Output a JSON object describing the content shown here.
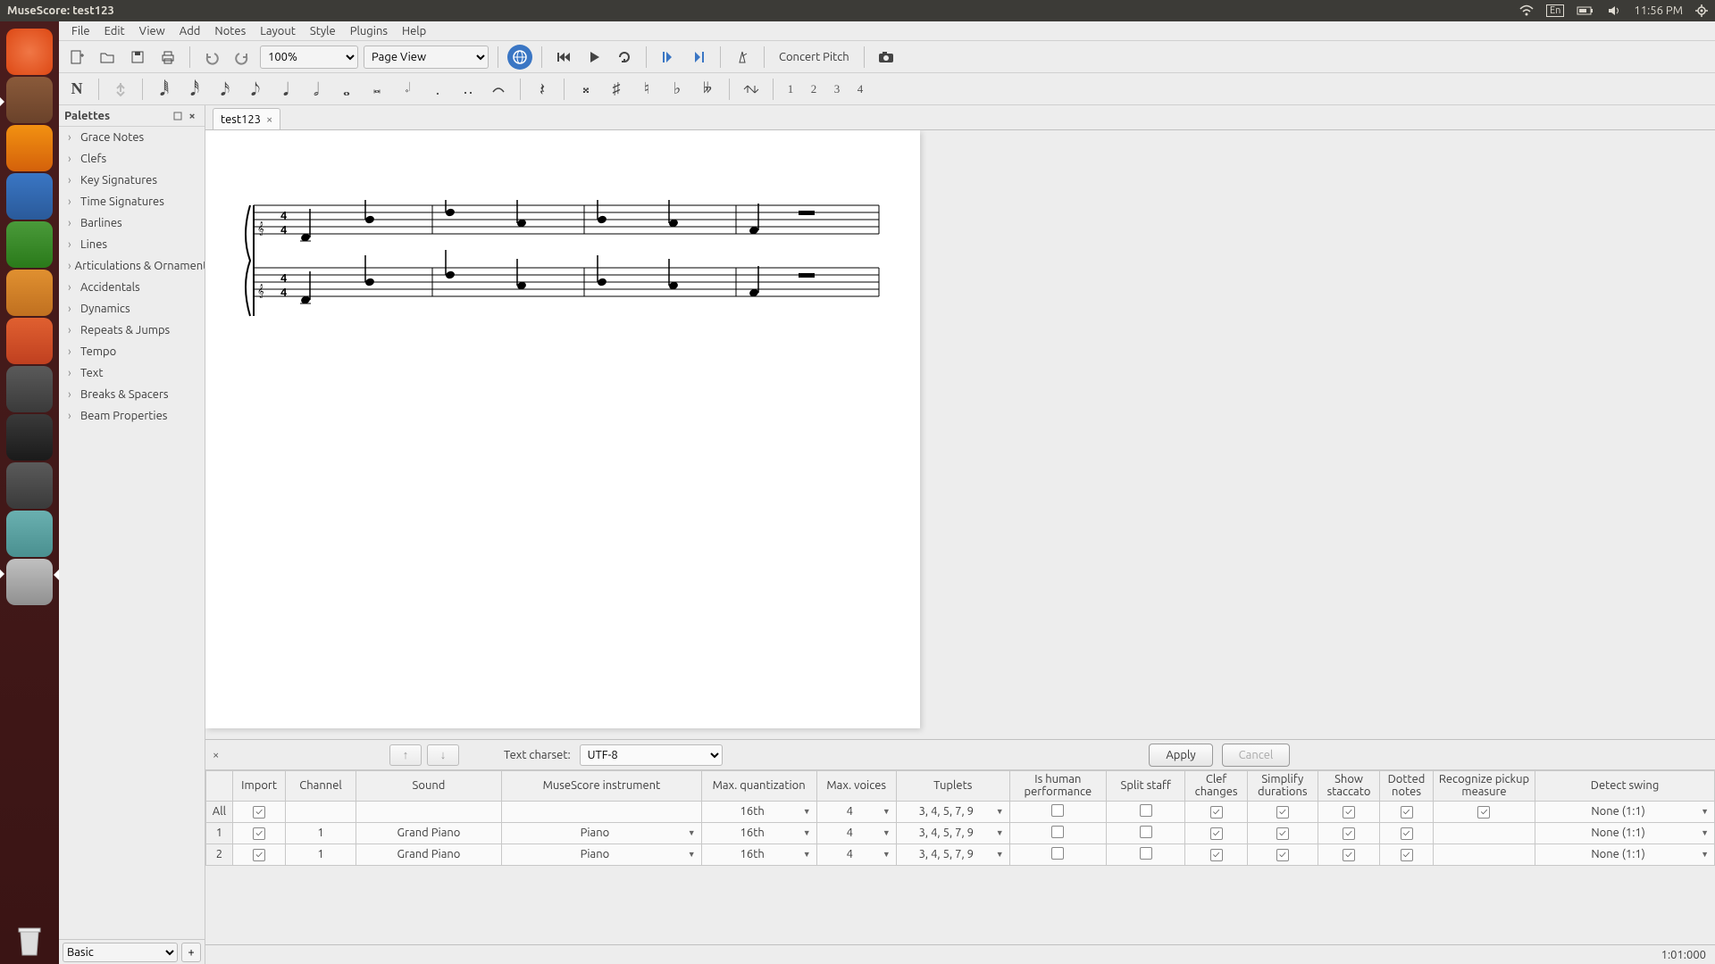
{
  "sysbar": {
    "title": "MuseScore: test123",
    "lang": "En",
    "clock": "11:56 PM"
  },
  "launcher": [
    {
      "name": "ubuntu-dash",
      "cls": "ubuntu"
    },
    {
      "name": "files",
      "cls": "files"
    },
    {
      "name": "firefox",
      "cls": "firefox"
    },
    {
      "name": "writer",
      "cls": "blue"
    },
    {
      "name": "calc",
      "cls": "green"
    },
    {
      "name": "impress",
      "cls": "orange"
    },
    {
      "name": "software-center",
      "cls": "store"
    },
    {
      "name": "settings",
      "cls": "grey"
    },
    {
      "name": "terminal",
      "cls": "dark"
    },
    {
      "name": "sublime",
      "cls": "subl"
    },
    {
      "name": "musescore",
      "cls": "teal"
    },
    {
      "name": "disk",
      "cls": "drive"
    }
  ],
  "menubar": [
    "File",
    "Edit",
    "View",
    "Add",
    "Notes",
    "Layout",
    "Style",
    "Plugins",
    "Help"
  ],
  "toolbar1": {
    "zoom": "100%",
    "view": "Page View",
    "concert_pitch": "Concert Pitch"
  },
  "voices": [
    "1",
    "2",
    "3",
    "4"
  ],
  "palettes": {
    "title": "Palettes",
    "items": [
      "Grace Notes",
      "Clefs",
      "Key Signatures",
      "Time Signatures",
      "Barlines",
      "Lines",
      "Articulations & Ornaments",
      "Accidentals",
      "Dynamics",
      "Repeats & Jumps",
      "Tempo",
      "Text",
      "Breaks & Spacers",
      "Beam Properties"
    ],
    "footer_sel": "Basic"
  },
  "tab": {
    "name": "test123"
  },
  "midi": {
    "charset_label": "Text charset:",
    "charset_value": "UTF-8",
    "apply": "Apply",
    "cancel": "Cancel",
    "headers": [
      "",
      "Import",
      "Channel",
      "Sound",
      "MuseScore instrument",
      "Max. quantization",
      "Max. voices",
      "Tuplets",
      "Is human performance",
      "Split staff",
      "Clef changes",
      "Simplify durations",
      "Show staccato",
      "Dotted notes",
      "Recognize pickup measure",
      "Detect swing"
    ],
    "row_all_label": "All",
    "rows": [
      {
        "id": "All",
        "import": true,
        "channel": "",
        "sound": "",
        "instrument": "",
        "quant": "16th",
        "voices": "4",
        "tuplets": "3, 4, 5, 7, 9",
        "human": false,
        "split": false,
        "clef": true,
        "simplify": true,
        "staccato": true,
        "dotted": true,
        "pickup": true,
        "swing": "None (1:1)"
      },
      {
        "id": "1",
        "import": true,
        "channel": "1",
        "sound": "Grand Piano",
        "instrument": "Piano",
        "quant": "16th",
        "voices": "4",
        "tuplets": "3, 4, 5, 7, 9",
        "human": false,
        "split": false,
        "clef": true,
        "simplify": true,
        "staccato": true,
        "dotted": true,
        "pickup": "",
        "swing": "None (1:1)"
      },
      {
        "id": "2",
        "import": true,
        "channel": "1",
        "sound": "Grand Piano",
        "instrument": "Piano",
        "quant": "16th",
        "voices": "4",
        "tuplets": "3, 4, 5, 7, 9",
        "human": false,
        "split": false,
        "clef": true,
        "simplify": true,
        "staccato": true,
        "dotted": true,
        "pickup": "",
        "swing": "None (1:1)"
      }
    ]
  },
  "statusbar": {
    "pos": "1:01:000"
  }
}
